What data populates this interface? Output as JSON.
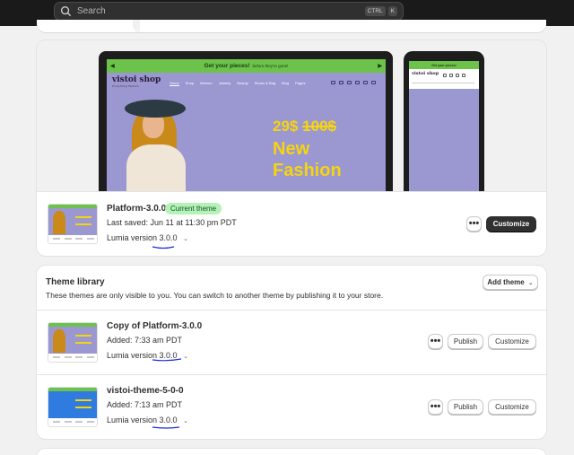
{
  "search": {
    "placeholder": "Search",
    "kbd1": "CTRL",
    "kbd2": "K"
  },
  "preview": {
    "announcement": "Get your pieces!",
    "announcement_small": "before they're gone!",
    "logo": "vistoi shop",
    "logo_tagline": "Everything Fashion",
    "nav": [
      "Home",
      "Shop",
      "Women",
      "Jewelry",
      "Beauty",
      "Shoes & Bag",
      "Blog",
      "Pages"
    ],
    "price_new": "29$",
    "price_old": "100$",
    "hero_line1": "New",
    "hero_line2": "Fashion",
    "phone_logo": "vistoi shop"
  },
  "current": {
    "name": "Platform-3.0.0",
    "badge": "Current theme",
    "saved": "Last saved: Jun 11 at 11:30 pm PDT",
    "version_label": "Lumia version",
    "version": "3.0.0",
    "more": "•••",
    "customize": "Customize"
  },
  "library": {
    "title": "Theme library",
    "description": "These themes are only visible to you. You can switch to another theme by publishing it to your store.",
    "add_theme": "Add theme",
    "themes": [
      {
        "name": "Copy of Platform-3.0.0",
        "added": "Added: 7:33 am PDT",
        "version_label": "Lumia version",
        "version": "3.0.0",
        "more": "•••",
        "publish": "Publish",
        "customize": "Customize"
      },
      {
        "name": "vistoi-theme-5-0-0",
        "added": "Added: 7:13 am PDT",
        "version_label": "Lumia version",
        "version": "3.0.0",
        "more": "•••",
        "publish": "Publish",
        "customize": "Customize"
      }
    ]
  },
  "colors": {
    "accent_green": "#6cc24a",
    "hero_purple": "#9b97d1",
    "hero_yellow": "#f6d410",
    "badge_bg": "#b5f2b5",
    "annotation_blue": "#1f2be0",
    "blue_theme": "#2f7be0"
  }
}
